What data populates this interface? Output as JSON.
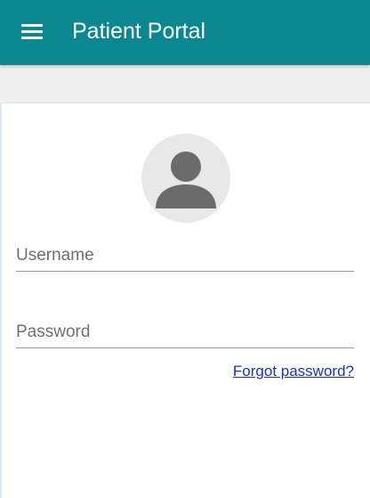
{
  "header": {
    "title": "Patient Portal",
    "menu_icon": "hamburger-menu-icon",
    "background_color": "#0b878f"
  },
  "profile": {
    "avatar_icon": "user-silhouette-icon"
  },
  "form": {
    "username": {
      "placeholder": "Username",
      "value": ""
    },
    "password": {
      "placeholder": "Password",
      "value": ""
    },
    "forgot_password_label": "Forgot password?"
  },
  "colors": {
    "accent": "#0b878f",
    "link": "#1a2fd1"
  }
}
